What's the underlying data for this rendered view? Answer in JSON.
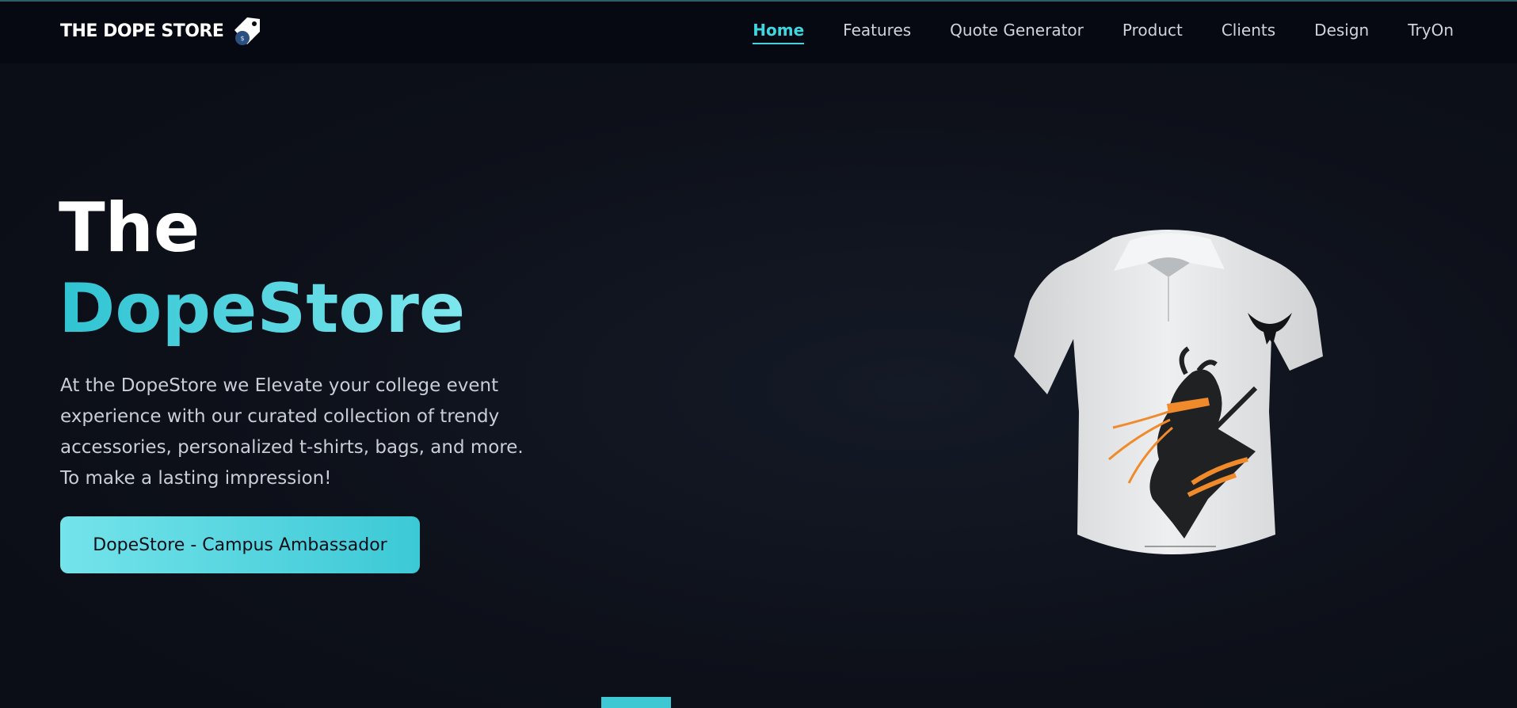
{
  "header": {
    "brand": "THE DOPE STORE",
    "nav": [
      "Home",
      "Features",
      "Quote Generator",
      "Product",
      "Clients",
      "Design",
      "TryOn"
    ],
    "active_index": 0
  },
  "hero": {
    "title_line1": "The",
    "title_line2": "DopeStore",
    "description": "At the DopeStore we Elevate your college event experience with our curated collection of trendy accessories, personalized t-shirts, bags, and more. To make a lasting impression!",
    "cta_label": "DopeStore - Campus Ambassador"
  },
  "colors": {
    "accent": "#3fd6df",
    "background": "#0b0e16",
    "shirt": "#e8e9ea",
    "print_orange": "#f08a2a"
  },
  "icons": {
    "brand_tag": "price-tag-icon",
    "shirt_emblem": "eagle-icon"
  }
}
